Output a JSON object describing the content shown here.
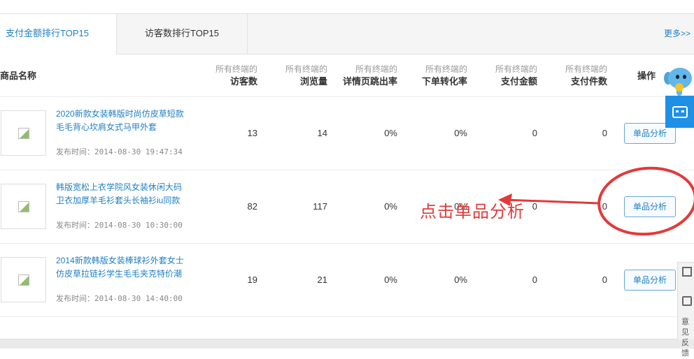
{
  "tabs": [
    {
      "label": "支付金额排行TOP15",
      "active": true
    },
    {
      "label": "访客数排行TOP15",
      "active": false
    }
  ],
  "more_label": "更多>>",
  "header": {
    "product_name": "商品名称",
    "sub": "所有终端的",
    "columns": [
      "访客数",
      "浏览量",
      "详情页跳出率",
      "下单转化率",
      "支付金额",
      "支付件数"
    ],
    "action": "操作"
  },
  "rows": [
    {
      "title": "2020新款女装韩版时尚仿皮草短款毛毛背心坎肩女式马甲外套",
      "time": "发布时间：2014-08-30 19:47:34",
      "visitors": "13",
      "pageviews": "14",
      "bounce": "0%",
      "conversion": "0%",
      "pay_amount": "0",
      "pay_count": "0",
      "action": "单品分析"
    },
    {
      "title": "韩版宽松上衣学院风女装休闲大码卫衣加厚羊毛衫套头长袖衫iu同款",
      "time": "发布时间：2014-08-30 10:30:00",
      "visitors": "82",
      "pageviews": "117",
      "bounce": "0%",
      "conversion": "0%",
      "pay_amount": "0",
      "pay_count": "0",
      "action": "单品分析"
    },
    {
      "title": "2014新款韩版女装棒球衫外套女士仿皮草拉链衫学生毛毛夹克特价潮",
      "time": "发布时间：2014-08-30 14:40:00",
      "visitors": "19",
      "pageviews": "21",
      "bounce": "0%",
      "conversion": "0%",
      "pay_amount": "0",
      "pay_count": "0",
      "action": "单品分析"
    }
  ],
  "annotation": "点击单品分析",
  "side_panel": {
    "feedback": "意见反馈",
    "feedback_line1": "意见",
    "feedback_line2": "反馈"
  },
  "colors": {
    "accent": "#1e7fc4",
    "annotation": "#e23a3a",
    "chat": "#1e90e6"
  },
  "icons": [
    "broken-image-icon",
    "elephant-mascot-icon",
    "chat-icon",
    "qr-code-icon",
    "edit-icon"
  ]
}
